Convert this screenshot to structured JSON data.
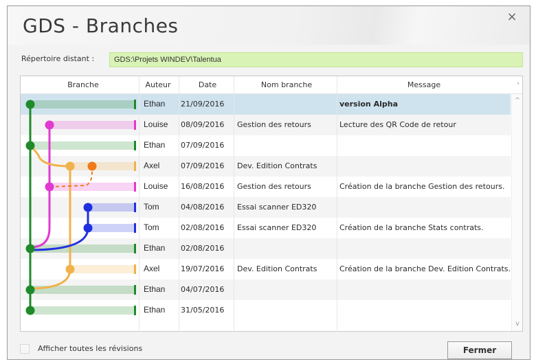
{
  "window": {
    "title": "GDS - Branches",
    "close_glyph": "×"
  },
  "repo": {
    "label": "Répertoire distant :",
    "value": "GDS:\\Projets WINDEV\\Talentua"
  },
  "columns": [
    "Branche",
    "Auteur",
    "Date",
    "Nom branche",
    "Message"
  ],
  "rows": [
    {
      "auteur": "Ethan",
      "date": "21/09/2016",
      "nom": "",
      "message": "version Alpha"
    },
    {
      "auteur": "Louise",
      "date": "08/09/2016",
      "nom": "Gestion des retours",
      "message": "Lecture des QR Code de retour"
    },
    {
      "auteur": "Ethan",
      "date": "07/09/2016",
      "nom": "",
      "message": ""
    },
    {
      "auteur": "Axel",
      "date": "07/09/2016",
      "nom": "Dev. Edition Contrats",
      "message": ""
    },
    {
      "auteur": "Louise",
      "date": "16/08/2016",
      "nom": "Gestion des retours",
      "message": "Création de la branche Gestion des retours."
    },
    {
      "auteur": "Tom",
      "date": "04/08/2016",
      "nom": "Essai scanner ED320",
      "message": ""
    },
    {
      "auteur": "Tom",
      "date": "02/08/2016",
      "nom": "Essai scanner ED320",
      "message": "Création de la branche Stats contrats."
    },
    {
      "auteur": "Ethan",
      "date": "02/08/2016",
      "nom": "",
      "message": ""
    },
    {
      "auteur": "Axel",
      "date": "19/07/2016",
      "nom": "Dev. Edition Contrats",
      "message": "Création de la branche Dev. Edition Contrats."
    },
    {
      "auteur": "Ethan",
      "date": "04/07/2016",
      "nom": "",
      "message": ""
    },
    {
      "auteur": "Ethan",
      "date": "31/05/2016",
      "nom": "",
      "message": ""
    }
  ],
  "branch_colors": {
    "main": "#1f8a2a",
    "retours": "#e03ad0",
    "contrats": "#f0b24a",
    "contrats_temp": "#f07a1a",
    "scanner": "#2030e0"
  },
  "footer": {
    "checkbox_label": "Afficher toutes les révisions",
    "checkbox_checked": false,
    "close_button": "Fermer"
  },
  "scrollbar": {
    "up_glyph": "^",
    "down_glyph": "v",
    "right_glyph": "›"
  }
}
